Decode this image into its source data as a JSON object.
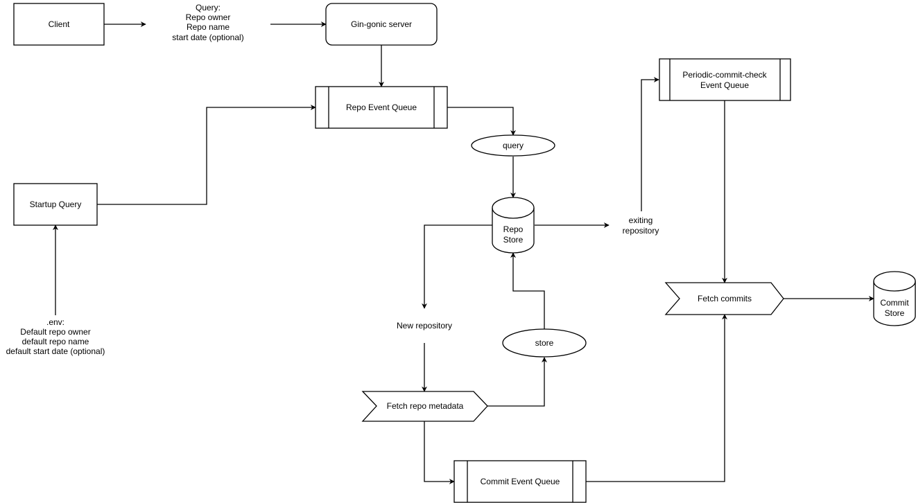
{
  "diagram": {
    "nodes": {
      "client": {
        "label": "Client",
        "shape": "rectangle"
      },
      "query_text": {
        "lines": [
          "Query:",
          "Repo owner",
          "Repo name",
          "start date (optional)"
        ],
        "shape": "text"
      },
      "gin_server": {
        "label": "Gin-gonic server",
        "shape": "rounded-rectangle"
      },
      "repo_event_queue": {
        "label": "Repo Event Queue",
        "shape": "process"
      },
      "startup_query": {
        "label": "Startup Query",
        "shape": "rectangle"
      },
      "env_text": {
        "lines": [
          ".env:",
          "Default repo owner",
          "default repo name",
          "default start date (optional)"
        ],
        "shape": "text"
      },
      "query_ellipse": {
        "label": "query",
        "shape": "ellipse"
      },
      "repo_store": {
        "lines": [
          "Repo",
          "Store"
        ],
        "shape": "cylinder"
      },
      "exiting_repository": {
        "lines": [
          "exiting",
          "repository"
        ],
        "shape": "text"
      },
      "periodic_queue": {
        "lines": [
          "Periodic-commit-check",
          "Event Queue"
        ],
        "shape": "process"
      },
      "new_repository": {
        "label": "New repository",
        "shape": "text"
      },
      "store_ellipse": {
        "label": "store",
        "shape": "ellipse"
      },
      "fetch_repo_metadata": {
        "label": "Fetch repo metadata",
        "shape": "step"
      },
      "commit_event_queue": {
        "label": "Commit Event Queue",
        "shape": "process"
      },
      "fetch_commits": {
        "label": "Fetch commits",
        "shape": "step"
      },
      "commit_store": {
        "lines": [
          "Commit",
          "Store"
        ],
        "shape": "cylinder"
      }
    },
    "edges": [
      {
        "from": "client",
        "to": "query_text"
      },
      {
        "from": "query_text",
        "to": "gin_server"
      },
      {
        "from": "gin_server",
        "to": "repo_event_queue"
      },
      {
        "from": "startup_query",
        "to": "repo_event_queue"
      },
      {
        "from": "env_text",
        "to": "startup_query"
      },
      {
        "from": "repo_event_queue",
        "to": "query_ellipse"
      },
      {
        "from": "query_ellipse",
        "to": "repo_store"
      },
      {
        "from": "repo_store",
        "to": "exiting_repository"
      },
      {
        "from": "exiting_repository",
        "to": "periodic_queue"
      },
      {
        "from": "repo_store",
        "to": "new_repository"
      },
      {
        "from": "new_repository",
        "to": "fetch_repo_metadata"
      },
      {
        "from": "fetch_repo_metadata",
        "to": "store_ellipse"
      },
      {
        "from": "store_ellipse",
        "to": "repo_store"
      },
      {
        "from": "fetch_repo_metadata",
        "to": "commit_event_queue"
      },
      {
        "from": "periodic_queue",
        "to": "fetch_commits"
      },
      {
        "from": "commit_event_queue",
        "to": "fetch_commits"
      },
      {
        "from": "fetch_commits",
        "to": "commit_store"
      }
    ]
  }
}
